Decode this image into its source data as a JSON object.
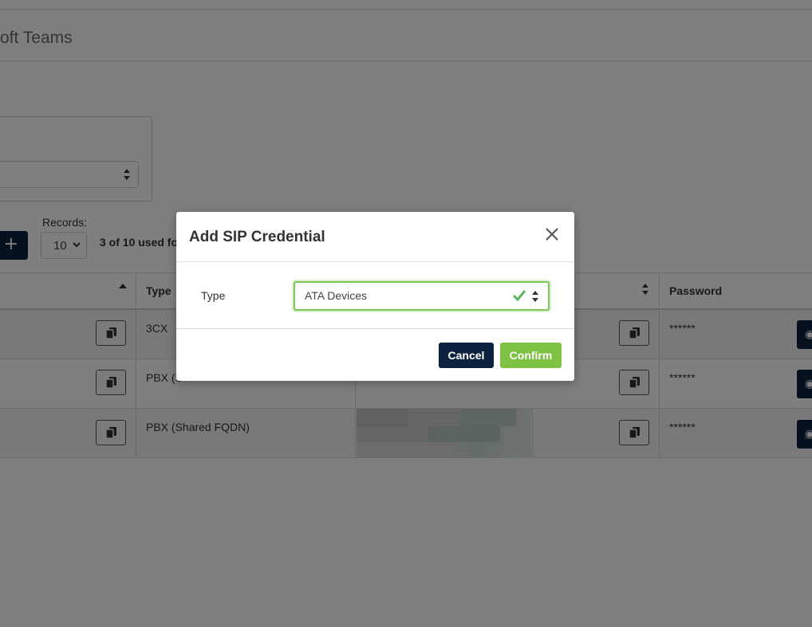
{
  "page": {
    "title": "oft Teams"
  },
  "toolbar": {
    "add_label": "+",
    "records_label": "Records:",
    "records_value": "10",
    "used_text": "3 of 10 used fo"
  },
  "table": {
    "headers": {
      "type": "Type",
      "password": "Password"
    },
    "rows": [
      {
        "type": "3CX",
        "password": "******"
      },
      {
        "type": "PBX (S",
        "password": "******"
      },
      {
        "type": "PBX (Shared FQDN)",
        "password": "******"
      }
    ]
  },
  "modal": {
    "title": "Add SIP Credential",
    "type_label": "Type",
    "type_value": "ATA Devices",
    "cancel_label": "Cancel",
    "confirm_label": "Confirm"
  },
  "colors": {
    "navy": "#0c2340",
    "green": "#7dc242",
    "valid_border": "#7dc65a"
  },
  "icons": [
    "close-icon",
    "check-icon",
    "sort-arrows-icon",
    "copy-icon",
    "eye-icon",
    "chevron-down-icon",
    "plus-icon"
  ]
}
